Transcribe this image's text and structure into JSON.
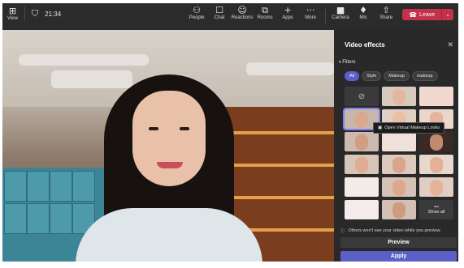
{
  "toolbar": {
    "view": {
      "label": "View",
      "icon": "grid-view-icon"
    },
    "time": "21:34",
    "people": {
      "label": "People",
      "icon": "people-icon"
    },
    "chat": {
      "label": "Chat",
      "icon": "chat-icon"
    },
    "reactions": {
      "label": "Reactions",
      "icon": "reactions-icon"
    },
    "rooms": {
      "label": "Rooms",
      "icon": "rooms-icon"
    },
    "apps": {
      "label": "Apps",
      "icon": "plus-icon"
    },
    "more": {
      "label": "More",
      "icon": "more-icon"
    },
    "camera": {
      "label": "Camera",
      "icon": "camera-icon"
    },
    "mic": {
      "label": "Mic",
      "icon": "mic-icon"
    },
    "share": {
      "label": "Share",
      "icon": "share-icon"
    },
    "leave": {
      "label": "Leave",
      "color": "#c4314b"
    }
  },
  "panel": {
    "title": "Video effects",
    "filters_label": "Filters",
    "chips": [
      "All",
      "Style",
      "Makeup",
      "makeup"
    ],
    "tooltip": "Open Virtual Makeup Looks",
    "show_all": "Show all",
    "info_text": "Others won't see your video while you preview.",
    "preview_label": "Preview",
    "apply_label": "Apply",
    "accent_color": "#5b5fc7"
  }
}
